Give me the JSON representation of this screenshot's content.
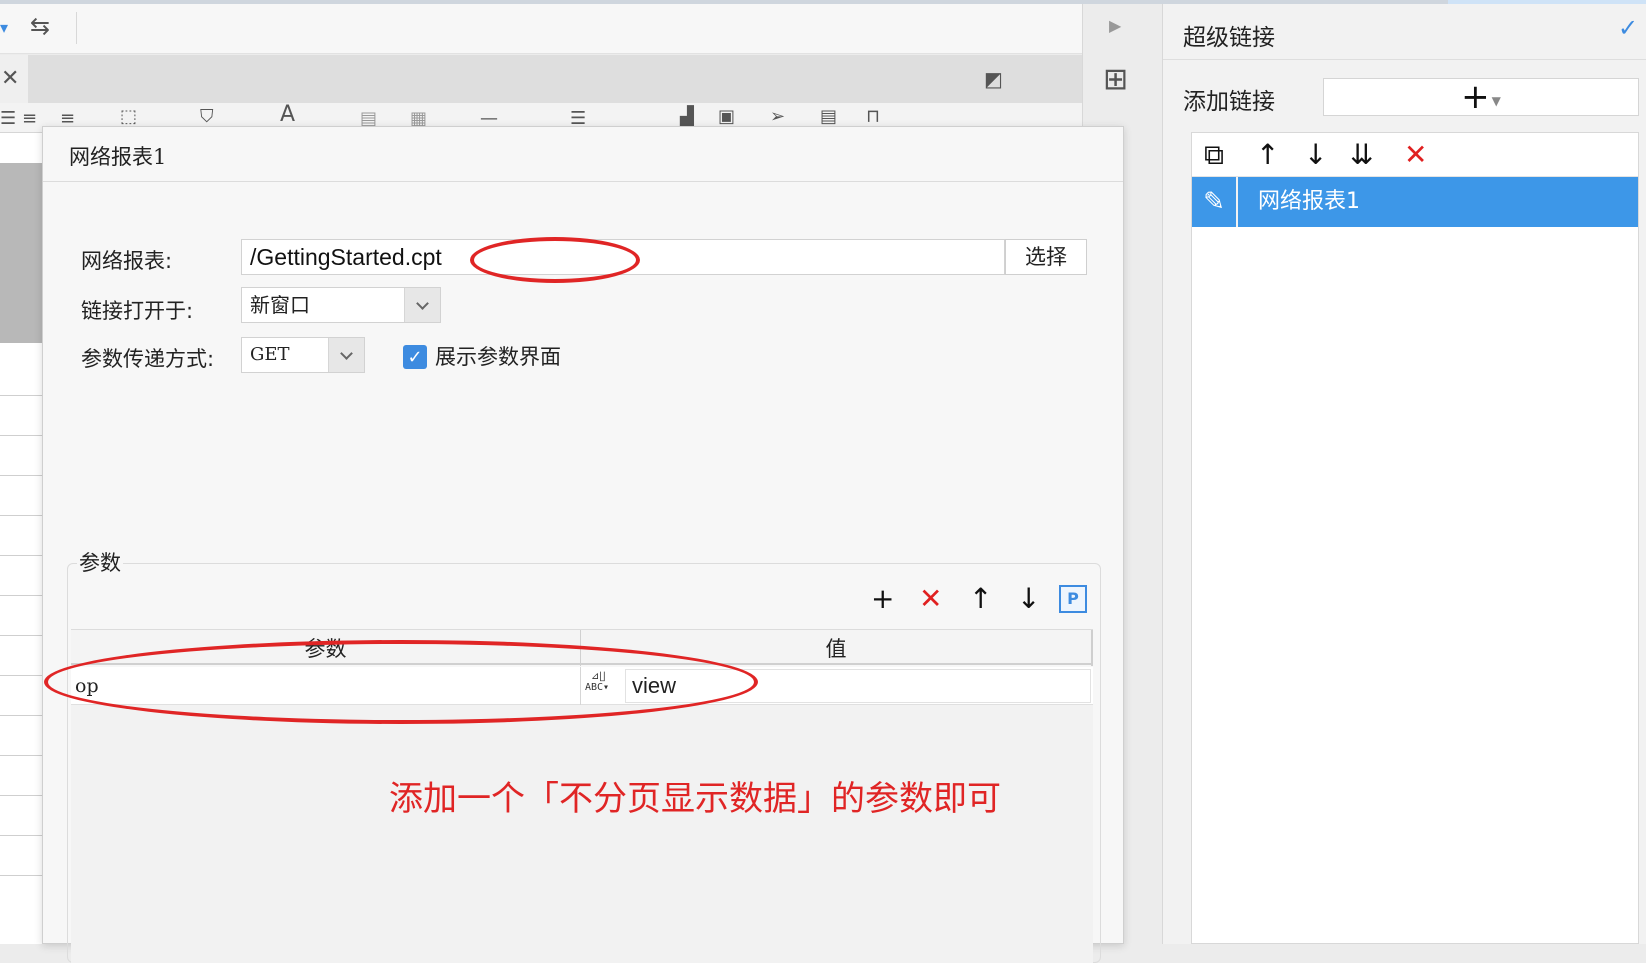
{
  "right_panel": {
    "title": "超级链接",
    "add_link_label": "添加链接",
    "add_link_button": "+",
    "list_items": [
      {
        "label": "网络报表1",
        "selected": true,
        "icon": "pencil-icon"
      }
    ],
    "tools": [
      "copy-icon",
      "move-up-icon",
      "move-down-icon",
      "sort-icon",
      "delete-icon"
    ]
  },
  "dialog": {
    "title": "网络报表1",
    "report_label": "网络报表:",
    "report_path": "/GettingStarted.cpt",
    "choose_button": "选择",
    "open_in_label": "链接打开于:",
    "open_in_value": "新窗口",
    "method_label": "参数传递方式:",
    "method_value": "GET",
    "show_params_checked": true,
    "show_params_label": "展示参数界面",
    "params_group_label": "参数",
    "params_table": {
      "columns": [
        "参数",
        "值"
      ],
      "rows": [
        {
          "param": "op",
          "value": "view"
        }
      ]
    },
    "params_tools": [
      "add-icon",
      "delete-icon",
      "move-up-icon",
      "move-down-icon",
      "p-param-icon"
    ]
  },
  "annotation": "添加一个「不分页显示数据」的参数即可",
  "colors": {
    "accent": "#3d97e8",
    "annotation_red": "#e02525",
    "delete_red": "#e02020"
  }
}
